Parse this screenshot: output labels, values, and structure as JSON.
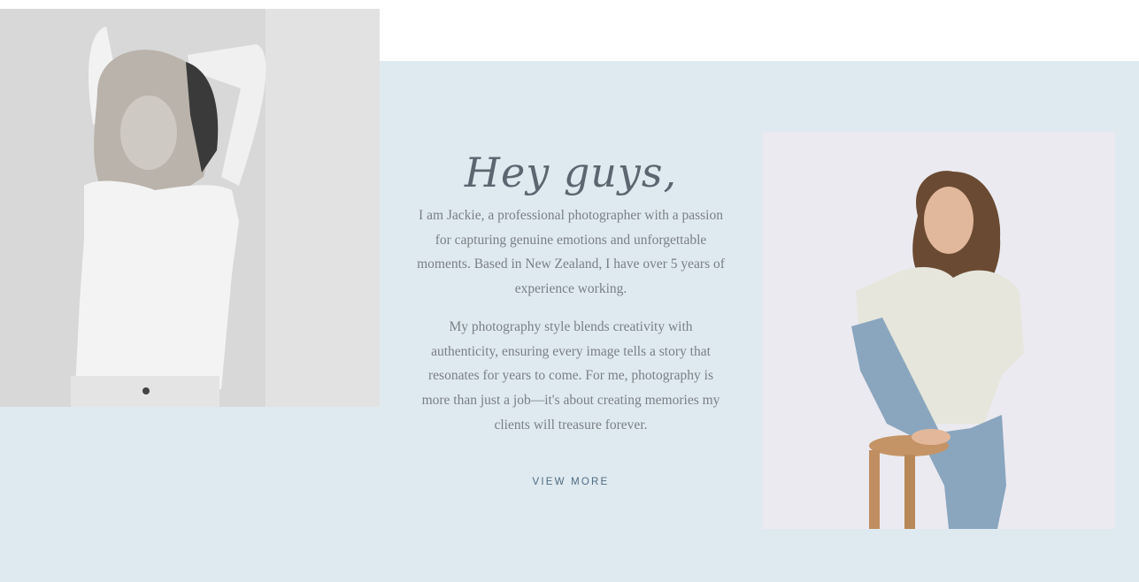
{
  "about": {
    "greeting": "Hey guys,",
    "paragraph_1": "I am Jackie, a professional photographer with a passion for capturing genuine emotions and unforgettable moments. Based in New Zealand, I have over 5 years of experience working.",
    "paragraph_2": "My photography style blends creativity with authenticity, ensuring every image tells a story that resonates for years to come. For me, photography is more than just a job—it's about creating memories my clients will treasure forever.",
    "cta_label": "VIEW MORE"
  },
  "colors": {
    "band_background": "#dfeaf0",
    "text": "#7a7f86",
    "heading": "#5b6670",
    "cta": "#4e6b82"
  }
}
